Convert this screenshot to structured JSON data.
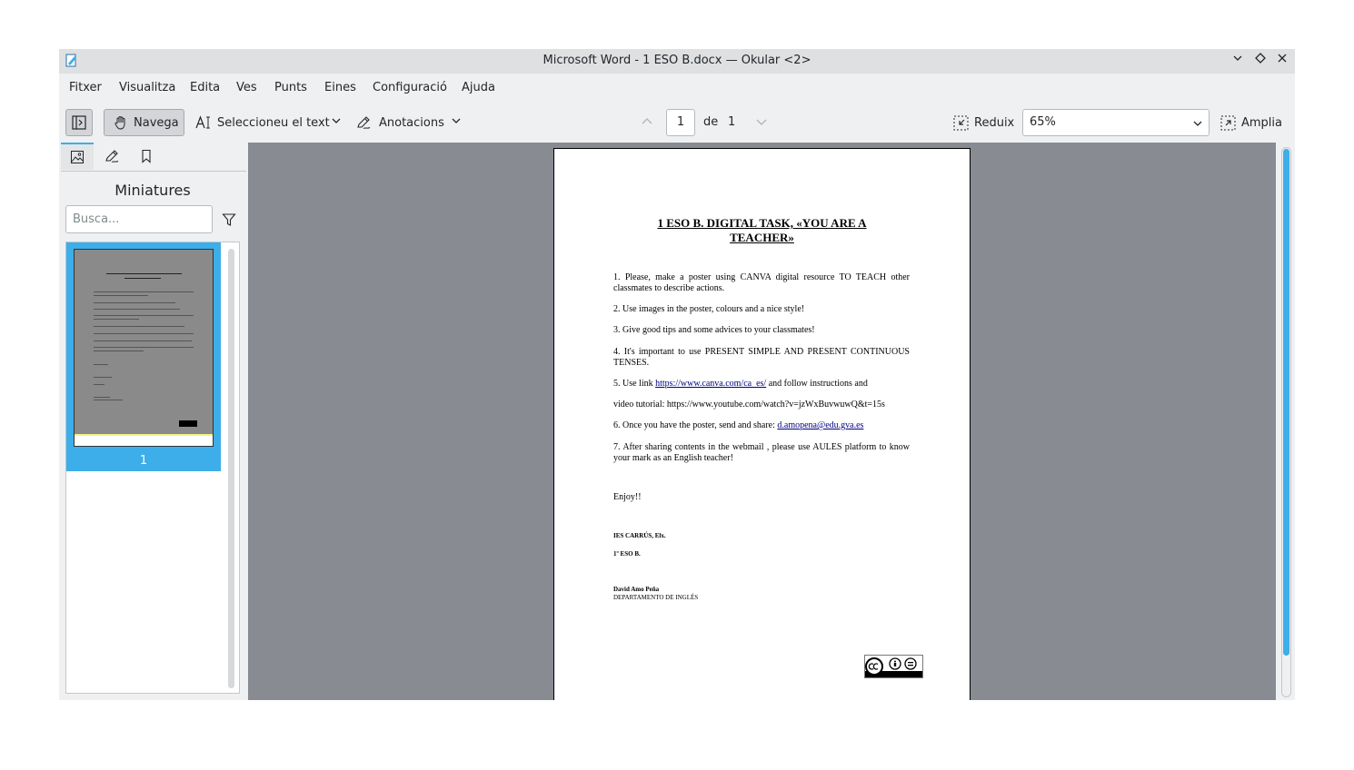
{
  "window": {
    "title": "Microsoft Word - 1 ESO B.docx — Okular <2>",
    "controls": [
      "minimize-icon",
      "maximize-icon",
      "close-icon"
    ]
  },
  "menu": [
    "Fitxer",
    "Visualitza",
    "Edita",
    "Ves",
    "Punts",
    "Eines",
    "Configuració",
    "Ajuda"
  ],
  "toolbar": {
    "navigate_label": "Navega",
    "select_text_label": "Seleccioneu el text",
    "annotations_label": "Anotacions",
    "page_current": "1",
    "page_of_label": "de",
    "page_total": "1",
    "zoom_out_label": "Reduix",
    "zoom_value": "65%",
    "zoom_in_label": "Amplia"
  },
  "sidebar": {
    "title": "Miniatures",
    "search_placeholder": "Busca...",
    "thumbnail_page_number": "1",
    "tabs": [
      "thumbnails-icon",
      "annotations-icon",
      "bookmarks-icon"
    ]
  },
  "document": {
    "title": "1 ESO B. DIGITAL TASK, «YOU ARE A TEACHER»",
    "items": [
      "1. Please, make a poster using CANVA digital resource TO TEACH other classmates to describe actions.",
      "2. Use images in the poster, colours and a nice style!",
      "3. Give good tips and some advices to your classmates!",
      "4. It's important to use PRESENT SIMPLE AND PRESENT CONTINUOUS TENSES."
    ],
    "item5_prefix": "5. Use link ",
    "item5_link": "https://www.canva.com/ca_es/",
    "item5_suffix": " and follow instructions and",
    "video_line": "video tutorial: https://www.youtube.com/watch?v=jzWxBuvwuwQ&t=15s",
    "item6_prefix": "6. Once you have the poster, send and share: ",
    "item6_link": "d.amopena@edu.gva.es",
    "item7": "7. After sharing contents in the webmail , please use AULES platform to know your mark as an English teacher!",
    "enjoy": "Enjoy!!",
    "school": "IES CARRÚS, Elx.",
    "group": "1º ESO B.",
    "author": "David Amo Peña",
    "department": "DEPARTAMENTO DE INGLÉS",
    "license_badge": "cc-by-nd-icon"
  },
  "colors": {
    "accent": "#3daee9",
    "viewer_bg": "#888b91",
    "window_bg": "#eff0f1",
    "link": "#000080"
  }
}
